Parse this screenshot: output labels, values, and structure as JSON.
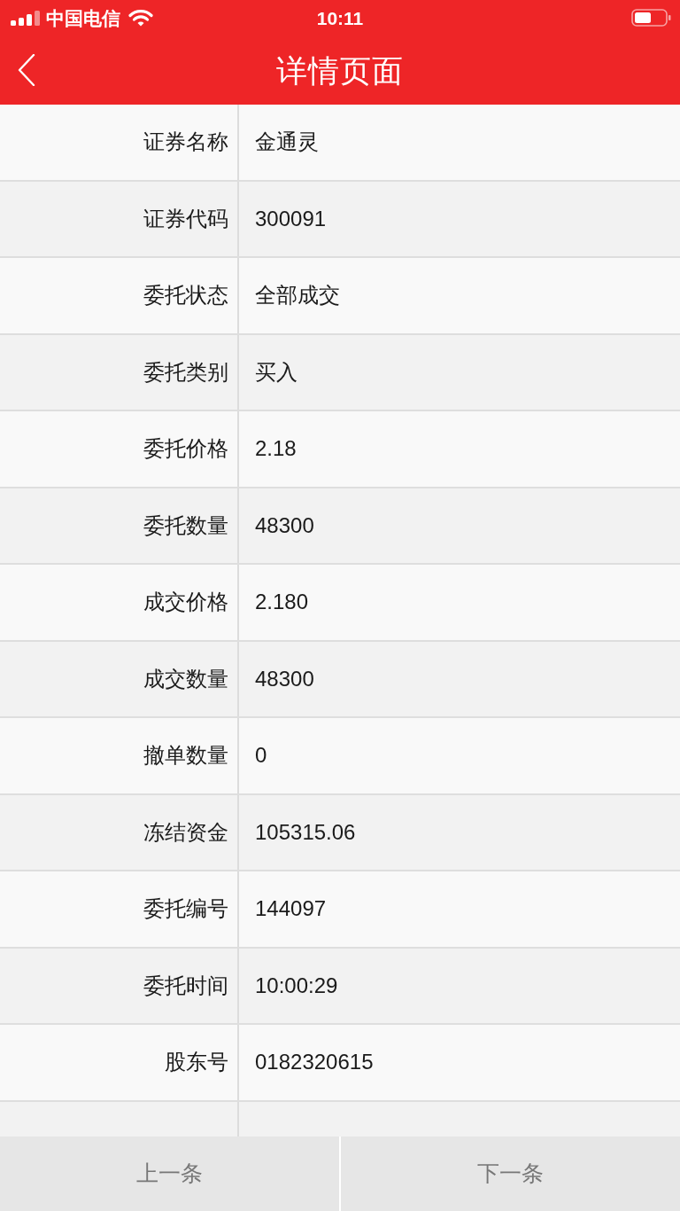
{
  "status_bar": {
    "carrier": "中国电信",
    "time": "10:11"
  },
  "nav_bar": {
    "title": "详情页面"
  },
  "details": [
    {
      "label": "证券名称",
      "value": "金通灵"
    },
    {
      "label": "证券代码",
      "value": "300091"
    },
    {
      "label": "委托状态",
      "value": "全部成交"
    },
    {
      "label": "委托类别",
      "value": "买入"
    },
    {
      "label": "委托价格",
      "value": "2.18"
    },
    {
      "label": "委托数量",
      "value": "48300"
    },
    {
      "label": "成交价格",
      "value": "2.180"
    },
    {
      "label": "成交数量",
      "value": "48300"
    },
    {
      "label": "撤单数量",
      "value": "0"
    },
    {
      "label": "冻结资金",
      "value": "105315.06"
    },
    {
      "label": "委托编号",
      "value": "144097"
    },
    {
      "label": "委托时间",
      "value": "10:00:29"
    },
    {
      "label": "股东号",
      "value": "0182320615"
    }
  ],
  "bottom_buttons": [
    {
      "label": "上一条"
    },
    {
      "label": "下一条"
    }
  ]
}
